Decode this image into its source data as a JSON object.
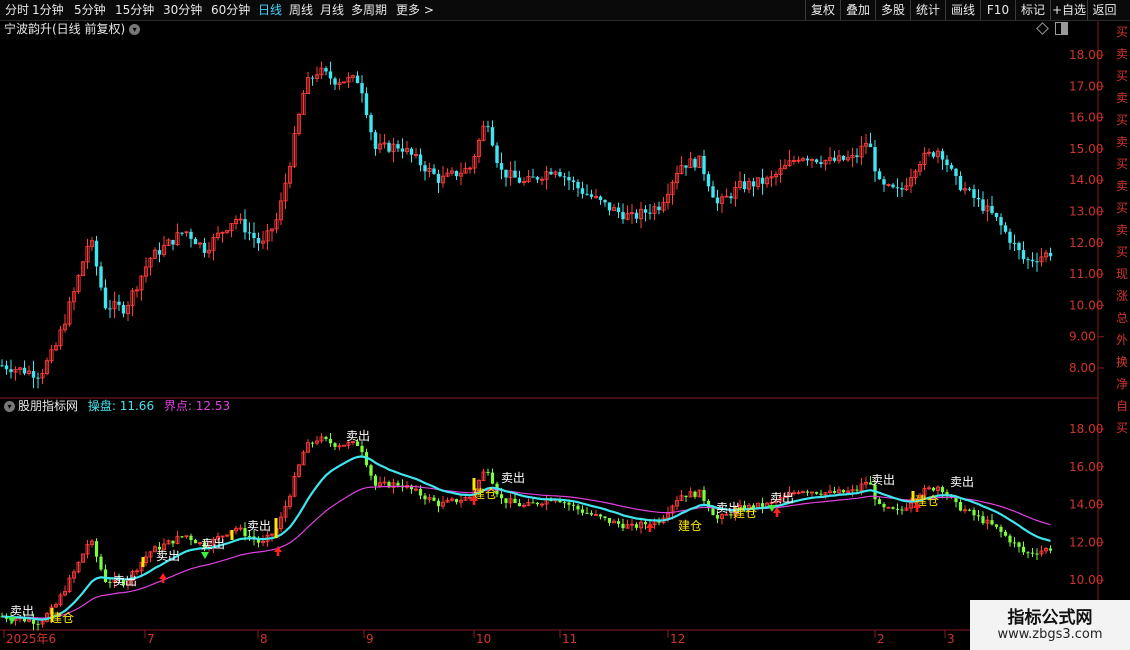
{
  "toolbar": {
    "periods": [
      "分时",
      "1分钟",
      "5分钟",
      "15分钟",
      "30分钟",
      "60分钟",
      "日线",
      "周线",
      "月线",
      "多周期",
      "更多 >"
    ],
    "active_period": "日线",
    "right_buttons": [
      "复权",
      "叠加",
      "多股",
      "统计",
      "画线",
      "F10",
      "标记",
      "+自选",
      "返回"
    ]
  },
  "main_chart": {
    "title": "宁波韵升(日线 前复权)",
    "price_ticks": [
      "18.00",
      "17.00",
      "16.00",
      "15.00",
      "14.00",
      "13.00",
      "12.00",
      "11.00",
      "10.00",
      "9.00",
      "8.00"
    ]
  },
  "indicator": {
    "name": "股朋指标网",
    "label1": "操盘:",
    "value1": "11.66",
    "label2": "界点:",
    "value2": "12.53",
    "price_ticks": [
      "18.00",
      "16.00",
      "14.00",
      "12.00",
      "10.00"
    ],
    "signal_labels": [
      {
        "text": "卖出",
        "type": "sell"
      },
      {
        "text": "建仓",
        "type": "buy"
      },
      {
        "text": "卖出",
        "type": "sell"
      },
      {
        "text": "卖出",
        "type": "sell"
      },
      {
        "text": "卖出",
        "type": "sell"
      },
      {
        "text": "卖出",
        "type": "sell"
      },
      {
        "text": "卖出",
        "type": "sell"
      },
      {
        "text": "建仓",
        "type": "buy"
      },
      {
        "text": "卖出",
        "type": "sell"
      },
      {
        "text": "建仓",
        "type": "buy"
      },
      {
        "text": "卖出",
        "type": "sell"
      },
      {
        "text": "建仓",
        "type": "buy"
      },
      {
        "text": "卖出",
        "type": "sell"
      },
      {
        "text": "卖出",
        "type": "sell"
      },
      {
        "text": "建仓",
        "type": "buy"
      },
      {
        "text": "卖出",
        "type": "sell"
      }
    ]
  },
  "time_axis": [
    "2025年6",
    "7",
    "8",
    "9",
    "10",
    "11",
    "12",
    "2",
    "3"
  ],
  "right_strip_chars": [
    "买",
    "卖",
    "买",
    "卖",
    "买",
    "卖",
    "买",
    "卖",
    "买",
    "卖",
    "买",
    "现",
    "涨",
    "总",
    "外",
    "换",
    "净",
    "自",
    "买"
  ],
  "watermark": {
    "line1": "指标公式网",
    "line2": "www.zbgs3.com"
  },
  "colors": {
    "up": "#ff3b3b",
    "down": "#3fe6f0",
    "ma": "#e040e0",
    "opline": "#3fe6f0",
    "buy_candle": "#7cfc3c",
    "sell_label": "#ffffff",
    "buy_label": "#ffe600",
    "grid_border": "#8a1c1c"
  }
}
